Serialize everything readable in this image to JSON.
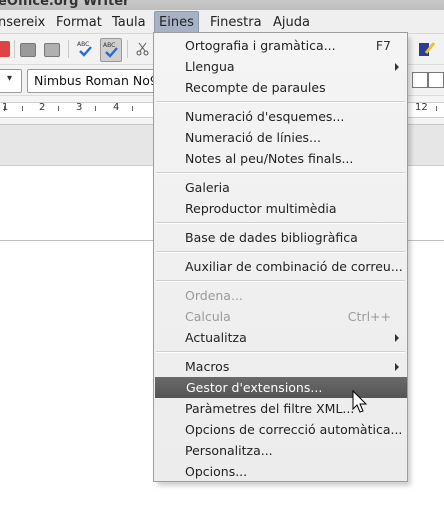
{
  "window": {
    "title": "eOffice.org Writer"
  },
  "menubar": {
    "items": [
      {
        "label": "nsereix"
      },
      {
        "label": "Format"
      },
      {
        "label": "Taula"
      },
      {
        "label": "Eines"
      },
      {
        "label": "Finestra"
      },
      {
        "label": "Ajuda"
      }
    ],
    "active": "Eines"
  },
  "formatting": {
    "style_arrow": "▾",
    "font_name": "Nimbus Roman No9"
  },
  "ruler": {
    "labels": [
      "1",
      "2",
      "3",
      "4",
      "12"
    ]
  },
  "tools_menu": {
    "items": [
      {
        "label": "Ortografia i gramàtica...",
        "shortcut": "F7"
      },
      {
        "label": "Llengua"
      },
      {
        "label": "Recompte de paraules"
      },
      {
        "label": "Numeració d'esquemes..."
      },
      {
        "label": "Numeració de línies..."
      },
      {
        "label": "Notes al peu/Notes finals..."
      },
      {
        "label": "Galeria"
      },
      {
        "label": "Reproductor multimèdia"
      },
      {
        "label": "Base de dades bibliogràfica"
      },
      {
        "label": "Auxiliar de combinació de correu..."
      },
      {
        "label": "Ordena..."
      },
      {
        "label": "Calcula",
        "shortcut": "Ctrl++"
      },
      {
        "label": "Actualitza"
      },
      {
        "label": "Macros"
      },
      {
        "label": "Gestor d'extensions..."
      },
      {
        "label": "Paràmetres del filtre XML..."
      },
      {
        "label": "Opcions de correcció automàtica..."
      },
      {
        "label": "Personalitza..."
      },
      {
        "label": "Opcions..."
      }
    ]
  },
  "colors": {
    "menu_highlight": "#5e5e5e",
    "menubar_active": "#a7b3c4",
    "disabled_text": "#9a9a9a"
  }
}
